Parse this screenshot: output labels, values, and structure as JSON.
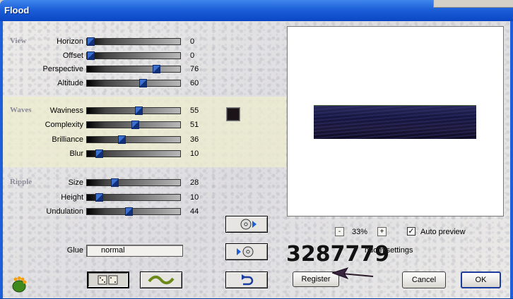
{
  "window": {
    "title": "Flood"
  },
  "sections": {
    "view": "View",
    "waves": "Waves",
    "ripple": "Ripple"
  },
  "sliders": [
    {
      "label": "Horizon",
      "value": "0",
      "fraction": 0.0
    },
    {
      "label": "Offset",
      "value": "0",
      "fraction": 0.0
    },
    {
      "label": "Perspective",
      "value": "76",
      "fraction": 0.76
    },
    {
      "label": "Altitude",
      "value": "60",
      "fraction": 0.6
    },
    {
      "label": "Waviness",
      "value": "55",
      "fraction": 0.55
    },
    {
      "label": "Complexity",
      "value": "51",
      "fraction": 0.51
    },
    {
      "label": "Brilliance",
      "value": "36",
      "fraction": 0.36
    },
    {
      "label": "Blur",
      "value": "10",
      "fraction": 0.1
    },
    {
      "label": "Size",
      "value": "28",
      "fraction": 0.28
    },
    {
      "label": "Height",
      "value": "10",
      "fraction": 0.1
    },
    {
      "label": "Undulation",
      "value": "44",
      "fraction": 0.44
    }
  ],
  "color_swatch": "#1a1418",
  "glue": {
    "label": "Glue",
    "value": "normal"
  },
  "preview": {
    "zoom_minus": "-",
    "zoom_value": "33%",
    "zoom_plus": "+",
    "auto_preview_label": "Auto preview",
    "auto_preview_checked": "✓",
    "random_settings_label": "ndom settings"
  },
  "buttons": {
    "register": "Register",
    "cancel": "Cancel",
    "ok": "OK"
  },
  "overlay_number": "3287779",
  "icons": {
    "play_disc": "disc-forward-icon",
    "disc_play": "disc-back-icon",
    "undo": "undo-arrow-icon",
    "dice": "dice-icon",
    "wave": "wave-icon",
    "logo": "plugin-logo-icon",
    "arrow": "pointer-arrow-icon"
  }
}
